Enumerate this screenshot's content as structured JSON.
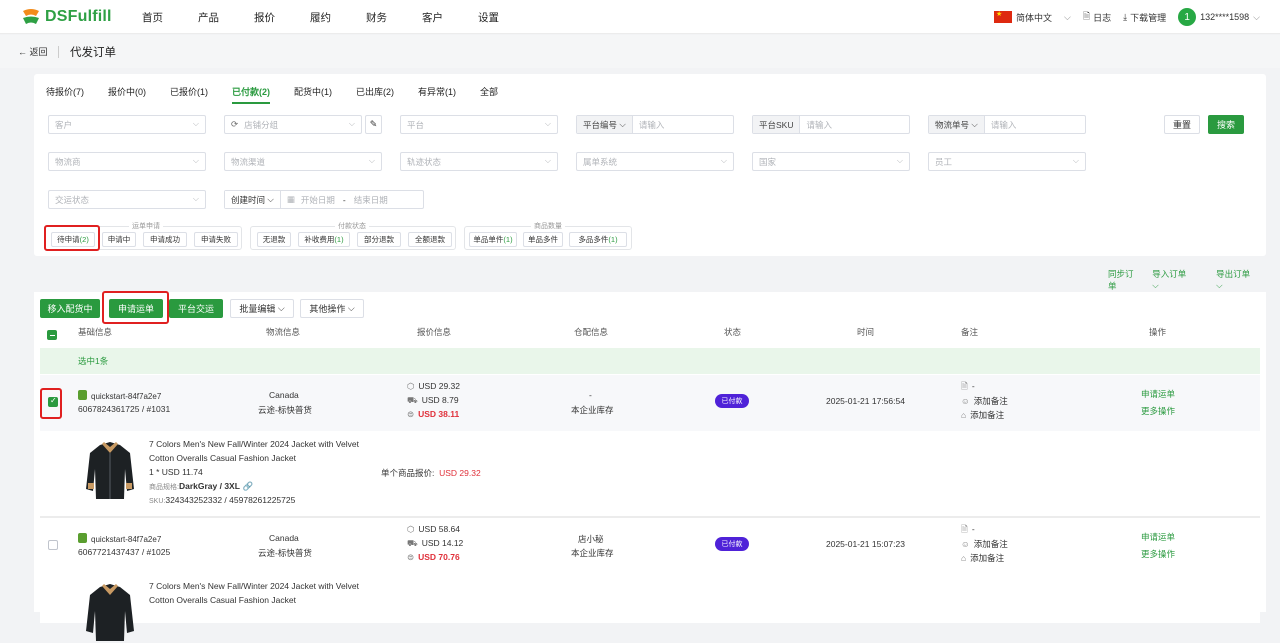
{
  "brand": {
    "logo_text": "DSFulfill"
  },
  "nav": {
    "items": [
      "首页",
      "产品",
      "报价",
      "履约",
      "财务",
      "客户",
      "设置"
    ]
  },
  "topright": {
    "language": "简体中文",
    "log": "日志",
    "download": "下载管理",
    "avatar_letter": "1",
    "user": "132****1598"
  },
  "subheader": {
    "back": "返回",
    "title": "代发订单"
  },
  "tabs": [
    "待报价(7)",
    "报价中(0)",
    "已报价(1)",
    "已付款(2)",
    "配货中(1)",
    "已出库(2)",
    "有异常(1)",
    "全部"
  ],
  "filters": {
    "customer": "客户",
    "store_group": "店铺分组",
    "platform": "平台",
    "platform_no_label": "平台编号",
    "platform_sku_label": "平台SKU",
    "tracking_label": "物流单号",
    "input_placeholder": "请输入",
    "logistics_provider": "物流商",
    "logistics_channel": "物流渠道",
    "track_status": "轨迹状态",
    "belong_system": "属单系统",
    "country": "国家",
    "staff": "员工",
    "dispute_status": "交运状态",
    "create_time": "创建时间",
    "start_date": "开始日期",
    "date_sep": "-",
    "end_date": "结束日期",
    "reset": "重置",
    "search": "搜索"
  },
  "groups": {
    "waybill": {
      "title": "运单申请",
      "chips": [
        "待申请",
        "申请中",
        "申请成功",
        "申请失败"
      ],
      "pending_count": "(2)"
    },
    "payment": {
      "title": "付款状态",
      "chips": [
        "无退款",
        "补收费用",
        "部分退款",
        "全额退款"
      ],
      "supplement_count": "(1)"
    },
    "qty": {
      "title": "商品数量",
      "chips": [
        "单品单件",
        "单品多件",
        "多品多件"
      ],
      "single_count": "(1)",
      "multi_count": "(1)"
    }
  },
  "actions": {
    "sync": "同步订单",
    "import": "导入订单",
    "export": "导出订单"
  },
  "toolbar": {
    "move": "移入配货中",
    "apply": "申请运单",
    "platform_ship": "平台交运",
    "batch_edit": "批量编辑",
    "other": "其他操作"
  },
  "table_headers": {
    "basic": "基础信息",
    "logistics": "物流信息",
    "quote": "报价信息",
    "warehouse": "仓配信息",
    "status": "状态",
    "time": "时间",
    "remark": "备注",
    "ops": "操作"
  },
  "selected_banner": "选中1条",
  "orders": [
    {
      "shop": "quickstart-84f7a2e7",
      "order_no": "6067824361725 / #1031",
      "country": "Canada",
      "channel": "云途-标快普货",
      "q1": "USD 29.32",
      "q2": "USD 8.79",
      "q3": "USD 38.11",
      "warehouse_top": "-",
      "warehouse": "本企业库存",
      "status": "已付款",
      "time": "2025-01-21 17:56:54",
      "remark1": "-",
      "remark2": "添加备注",
      "remark3": "添加备注",
      "op1": "申请运单",
      "op2": "更多操作",
      "product": {
        "title1": "7 Colors Men's New Fall/Winter 2024 Jacket with Velvet",
        "title2": "Cotton Overalls Casual Fashion Jacket",
        "price_line": "1 * USD 11.74",
        "spec_label": "商品规格:",
        "spec": "DarkGray / 3XL",
        "sku_label": "SKU:",
        "sku": "324343252332 / 45978261225725",
        "unit_quote_label": "单个商品报价:",
        "unit_quote": "USD 29.32"
      }
    },
    {
      "shop": "quickstart-84f7a2e7",
      "order_no": "6067721437437 / #1025",
      "country": "Canada",
      "channel": "云途-标快普货",
      "q1": "USD 58.64",
      "q2": "USD 14.12",
      "q3": "USD 70.76",
      "warehouse_top": "店小秘",
      "warehouse": "本企业库存",
      "status": "已付款",
      "time": "2025-01-21 15:07:23",
      "remark1": "-",
      "remark2": "添加备注",
      "remark3": "添加备注",
      "op1": "申请运单",
      "op2": "更多操作",
      "product": {
        "title1": "7 Colors Men's New Fall/Winter 2024 Jacket with Velvet",
        "title2": "Cotton Overalls Casual Fashion Jacket"
      }
    }
  ],
  "colors": {
    "brand": "#2a9a3f",
    "paid_badge": "#4f22d8",
    "total": "#e0303a",
    "highlight": "#e02020"
  }
}
